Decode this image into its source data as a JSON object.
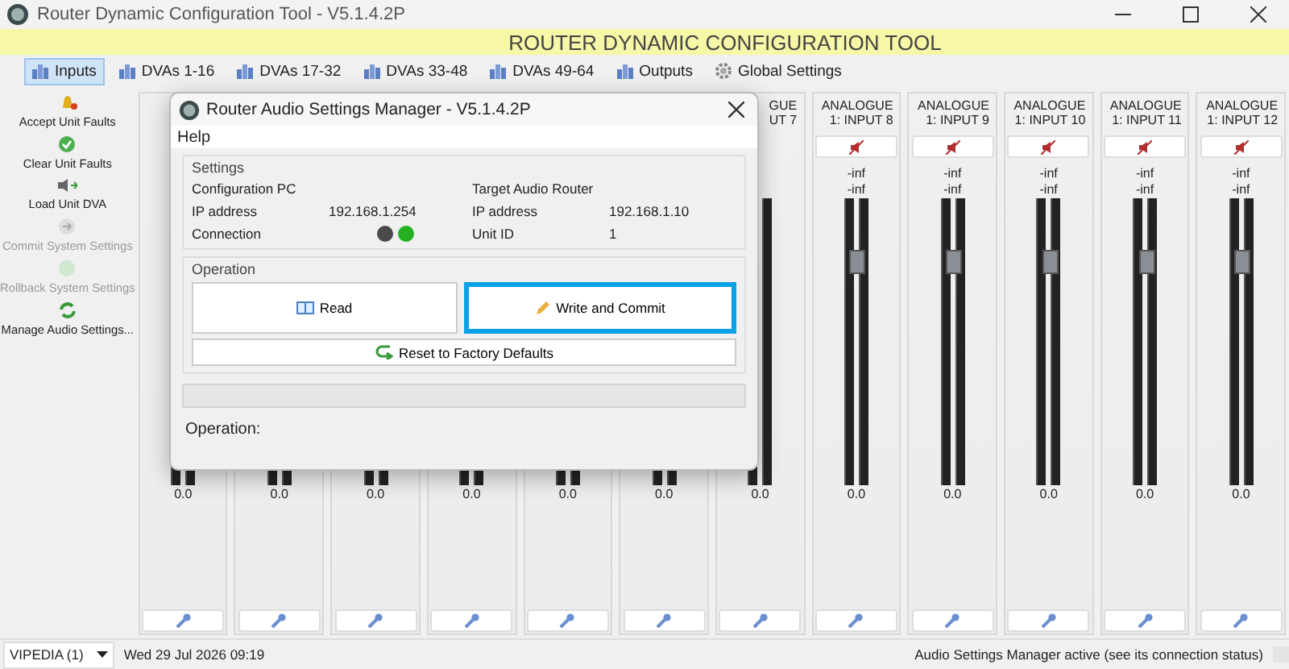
{
  "window": {
    "title": "Router Dynamic Configuration Tool - V5.1.4.2P"
  },
  "banner": "ROUTER DYNAMIC CONFIGURATION TOOL",
  "tabs": [
    {
      "label": "Inputs",
      "selected": true,
      "kind": "bars"
    },
    {
      "label": "DVAs 1-16",
      "selected": false,
      "kind": "bars"
    },
    {
      "label": "DVAs 17-32",
      "selected": false,
      "kind": "bars"
    },
    {
      "label": "DVAs 33-48",
      "selected": false,
      "kind": "bars"
    },
    {
      "label": "DVAs 49-64",
      "selected": false,
      "kind": "bars"
    },
    {
      "label": "Outputs",
      "selected": false,
      "kind": "bars"
    },
    {
      "label": "Global Settings",
      "selected": false,
      "kind": "gear"
    }
  ],
  "sidebar": {
    "items": [
      {
        "label": "Accept Unit Faults",
        "disabled": false,
        "kind": "bell"
      },
      {
        "label": "Clear Unit Faults",
        "disabled": false,
        "kind": "check"
      },
      {
        "label": "Load Unit DVA",
        "disabled": false,
        "kind": "speaker"
      },
      {
        "label": "Commit System Settings",
        "disabled": true,
        "kind": "arrow"
      },
      {
        "label": "Rollback System Settings",
        "disabled": true,
        "kind": "undo"
      },
      {
        "label": "Manage Audio Settings...",
        "disabled": false,
        "kind": "sync"
      }
    ]
  },
  "channels": [
    {
      "value": "0.0"
    },
    {
      "value": "0.0"
    },
    {
      "value": "0.0"
    },
    {
      "value": "0.0"
    },
    {
      "value": "0.0"
    },
    {
      "value": "0.0"
    },
    {
      "header": [
        "GUE",
        "UT 7"
      ],
      "value": "0.0"
    },
    {
      "header": [
        "ANALOGUE",
        "1: INPUT 8"
      ],
      "readings": [
        "-inf",
        "-inf"
      ],
      "muted": true,
      "level": 0.84,
      "value": "0.0"
    },
    {
      "header": [
        "ANALOGUE",
        "1: INPUT 9"
      ],
      "readings": [
        "-inf",
        "-inf"
      ],
      "muted": true,
      "level": 0.84,
      "value": "0.0"
    },
    {
      "header": [
        "ANALOGUE",
        "1: INPUT 10"
      ],
      "readings": [
        "-inf",
        "-inf"
      ],
      "muted": true,
      "level": 0.84,
      "value": "0.0"
    },
    {
      "header": [
        "ANALOGUE",
        "1: INPUT 11"
      ],
      "readings": [
        "-inf",
        "-inf"
      ],
      "muted": true,
      "level": 0.84,
      "value": "0.0"
    },
    {
      "header": [
        "ANALOGUE",
        "1: INPUT 12"
      ],
      "readings": [
        "-inf",
        "-inf"
      ],
      "muted": true,
      "level": 0.84,
      "value": "0.0"
    }
  ],
  "dialog": {
    "title": "Router Audio Settings Manager - V5.1.4.2P",
    "menu": [
      "Help"
    ],
    "settings": {
      "title": "Settings",
      "left": {
        "heading": "Configuration PC",
        "rows": [
          {
            "label": "IP address",
            "value": "192.168.1.254"
          },
          {
            "label": "Connection",
            "leds": [
              {
                "color": "#4a4a4a"
              },
              {
                "color": "#22b022"
              }
            ]
          }
        ]
      },
      "right": {
        "heading": "Target Audio Router",
        "rows": [
          {
            "label": "IP address",
            "value": "192.168.1.10"
          },
          {
            "label": "Unit ID",
            "value": "1"
          }
        ]
      }
    },
    "operation": {
      "title": "Operation",
      "buttons": [
        {
          "label": "Read",
          "kind": "book",
          "focused": false
        },
        {
          "label": "Write and Commit",
          "kind": "pencil",
          "focused": true
        }
      ],
      "reset": {
        "label": "Reset to Factory Defaults"
      }
    },
    "status": "Operation:"
  },
  "status_bar": {
    "dropdown": "VIPEDIA (1)",
    "datetime": "Wed 29 Jul 2026 09:19",
    "message": "Audio Settings Manager active (see its connection status)"
  }
}
